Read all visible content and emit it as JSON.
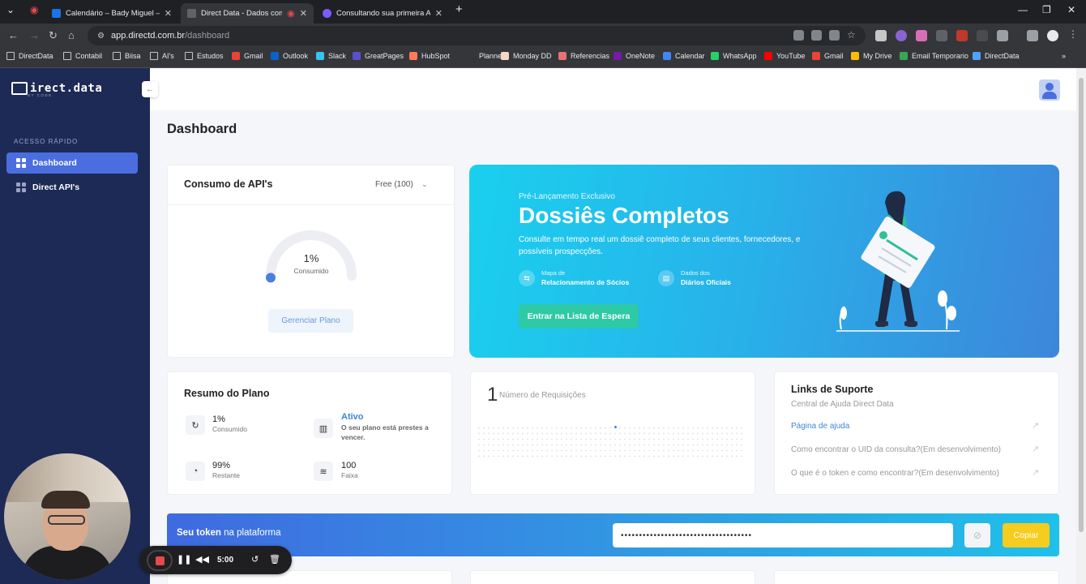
{
  "browser": {
    "tabs": [
      {
        "title": "Calendário – Bady Miguel – Ou",
        "color": "#1a73e8"
      },
      {
        "title": "Direct Data - Dados com Ve",
        "color": "#5f6368"
      },
      {
        "title": "Consultando sua primeira API n",
        "color": "#7c5cff"
      }
    ],
    "url_host": "app.directd.com.br",
    "url_path": "/dashboard",
    "bookmarks": [
      {
        "label": "DirectData",
        "icon": "folder-icon"
      },
      {
        "label": "Contabil",
        "icon": "folder-icon"
      },
      {
        "label": "Biisa",
        "icon": "folder-icon"
      },
      {
        "label": "AI's",
        "icon": "folder-icon"
      },
      {
        "label": "Estudos",
        "icon": "folder-icon"
      },
      {
        "label": "Gmail",
        "icon": "gmail-icon",
        "color": "#ea4335"
      },
      {
        "label": "Outlook",
        "icon": "outlook-icon",
        "color": "#0a64c8"
      },
      {
        "label": "Slack",
        "icon": "slack-icon",
        "color": "#36c5f0"
      },
      {
        "label": "GreatPages",
        "icon": "greatpages-icon",
        "color": "#5a4fcf"
      },
      {
        "label": "HubSpot",
        "icon": "hubspot-icon",
        "color": "#ff7a59"
      },
      {
        "label": "Planner",
        "icon": "planner-icon",
        "color": "#35363a"
      },
      {
        "label": "Monday DD",
        "icon": "monday-icon",
        "color": "#f4d7c5"
      },
      {
        "label": "Referencias",
        "icon": "referencias-icon",
        "color": "#e57373"
      },
      {
        "label": "OneNote",
        "icon": "onenote-icon",
        "color": "#7719aa"
      },
      {
        "label": "Calendar",
        "icon": "calendar-icon",
        "color": "#4285f4"
      },
      {
        "label": "WhatsApp",
        "icon": "whatsapp-icon",
        "color": "#25d366"
      },
      {
        "label": "YouTube",
        "icon": "youtube-icon",
        "color": "#ff0000"
      },
      {
        "label": "Gmail",
        "icon": "gmail-icon",
        "color": "#ea4335"
      },
      {
        "label": "My Drive",
        "icon": "drive-icon",
        "color": "#fbbc04"
      },
      {
        "label": "Email Temporario",
        "icon": "email-temp-icon",
        "color": "#34a853"
      },
      {
        "label": "DirectData",
        "icon": "cloud-icon",
        "color": "#4fa3ff"
      }
    ]
  },
  "sidebar": {
    "logo": "irect.data",
    "logo_sub": "BY CODE",
    "section": "ACESSO RÁPIDO",
    "items": [
      {
        "label": "Dashboard",
        "active": true
      },
      {
        "label": "Direct API's",
        "active": false
      }
    ]
  },
  "page": {
    "title": "Dashboard"
  },
  "consumo": {
    "title": "Consumo de API's",
    "plan_select": "Free (100)",
    "gauge_value": "1%",
    "gauge_fraction": 0.01,
    "gauge_label": "Consumido",
    "manage_button": "Gerenciar Plano"
  },
  "banner": {
    "pre": "Pré-Lançamento Exclusivo",
    "title": "Dossiês Completos",
    "description": "Consulte em tempo real um dossiê completo de seus clientes, fornecedores, e possíveis prospecções.",
    "features": [
      {
        "small": "Mapa de",
        "bold": "Relacionamento de Sócios"
      },
      {
        "small": "Dados dos",
        "bold": "Diários Oficiais"
      }
    ],
    "button": "Entrar na Lista de Espera"
  },
  "resumo": {
    "title": "Resumo do Plano",
    "stats": [
      {
        "value": "1%",
        "label": "Consumido"
      },
      {
        "value": "99%",
        "label": "Restante"
      },
      {
        "value": "100",
        "label": "Faixa"
      }
    ],
    "status_value": "Ativo",
    "status_desc": "O seu plano está prestes a vencer."
  },
  "requisicoes": {
    "count": "1",
    "label": "Número de Requisições"
  },
  "suporte": {
    "title": "Links de Suporte",
    "subtitle": "Central de Ajuda Direct Data",
    "links": [
      "Página de ajuda",
      "Como encontrar o UID da consulta?(Em desenvolvimento)",
      "O que é o token e como encontrar?(Em desenvolvimento)"
    ]
  },
  "token": {
    "title_bold": "Seu token",
    "title_rest": " na plataforma",
    "value": "••••••••••••••••••••••••••••••••••••",
    "copy_button": "Copiar"
  },
  "recorder": {
    "time": "5:00"
  },
  "colors": {
    "sidebar": "#1e2a56",
    "accent": "#4a6ee0",
    "banner_start": "#1ad0ee",
    "banner_end": "#3d86da",
    "cta": "#2ec9a6",
    "copy": "#f6cc1e"
  }
}
